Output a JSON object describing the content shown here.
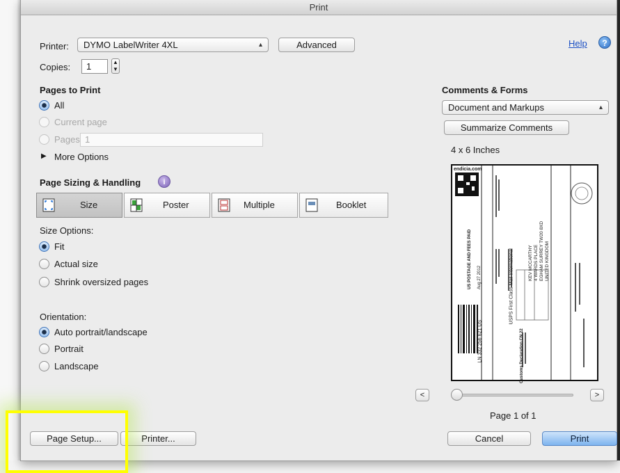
{
  "window": {
    "title": "Print"
  },
  "printer": {
    "label": "Printer:",
    "selected": "DYMO LabelWriter 4XL",
    "advanced_label": "Advanced",
    "help_label": "Help",
    "help_icon": "?"
  },
  "copies": {
    "label": "Copies:",
    "value": "1"
  },
  "pages_to_print": {
    "heading": "Pages to Print",
    "all": "All",
    "current_page": "Current page",
    "pages": "Pages",
    "pages_value": "1",
    "more_options": "More Options"
  },
  "sizing": {
    "heading": "Page Sizing & Handling",
    "info_icon": "i",
    "tabs": [
      "Size",
      "Poster",
      "Multiple",
      "Booklet"
    ],
    "size_options_label": "Size Options:",
    "options": [
      "Fit",
      "Actual size",
      "Shrink oversized pages"
    ]
  },
  "orientation": {
    "label": "Orientation:",
    "options": [
      "Auto portrait/landscape",
      "Portrait",
      "Landscape"
    ]
  },
  "comments_forms": {
    "heading": "Comments & Forms",
    "selected": "Document and Markups",
    "summarize_label": "Summarize Comments",
    "paper_size": "4 x 6 Inches"
  },
  "preview": {
    "brand": "endicia.com",
    "line_usps": "USPS First Class Mail International",
    "recipient": "KEV MCCARTHY\n4 WARDS PLACE\nEGHAM SURREY TW20 8XD\nUNITED KINGDOM",
    "customs": "Customs Declaration   CN 22",
    "tracking": "LN 332 256 621 US",
    "date": "Aug 27 2012",
    "postage": "US POSTAGE AND FEES PAID"
  },
  "navigation": {
    "prev": "<",
    "next": ">",
    "page_text": "Page 1 of 1"
  },
  "footer": {
    "page_setup": "Page Setup...",
    "printer": "Printer...",
    "cancel": "Cancel",
    "print": "Print"
  }
}
